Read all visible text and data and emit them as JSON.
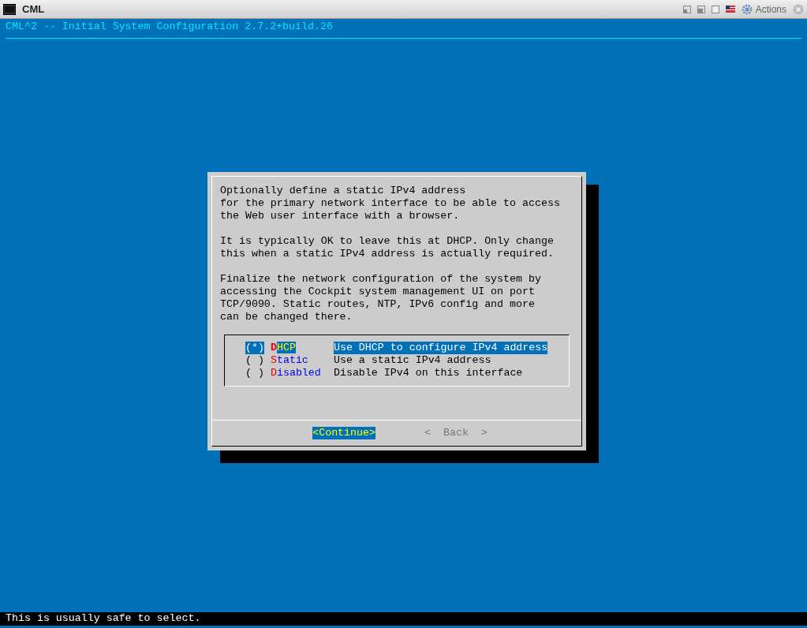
{
  "window": {
    "title": "CML",
    "actions_label": "Actions"
  },
  "header": {
    "title": "CML^2 -- Initial System Configuration 2.7.2+build.26"
  },
  "dialog": {
    "paragraphs": [
      [
        "Optionally define a static IPv4 address",
        "for the primary network interface to be able to access",
        "the Web user interface with a browser."
      ],
      [
        "It is typically OK to leave this at DHCP. Only change",
        "this when a static IPv4 address is actually required."
      ],
      [
        "Finalize the network configuration of the system by",
        "accessing the Cockpit system management UI on port",
        "TCP/9090. Static routes, NTP, IPv6 config and more",
        "can be changed there."
      ]
    ],
    "options": [
      {
        "marker": "(*)",
        "label": "DHCP",
        "description": "Use DHCP to configure IPv4 address",
        "selected": true
      },
      {
        "marker": "( )",
        "label": "Static",
        "description": "Use a static IPv4 address",
        "selected": false
      },
      {
        "marker": "( )",
        "label": "Disabled",
        "description": "Disable IPv4 on this interface",
        "selected": false
      }
    ],
    "buttons": [
      {
        "label": "<Continue>",
        "selected": true,
        "disabled": false
      },
      {
        "label": "<  Back  >",
        "selected": false,
        "disabled": true
      }
    ]
  },
  "status_bar": {
    "text": "This is usually safe to select."
  }
}
